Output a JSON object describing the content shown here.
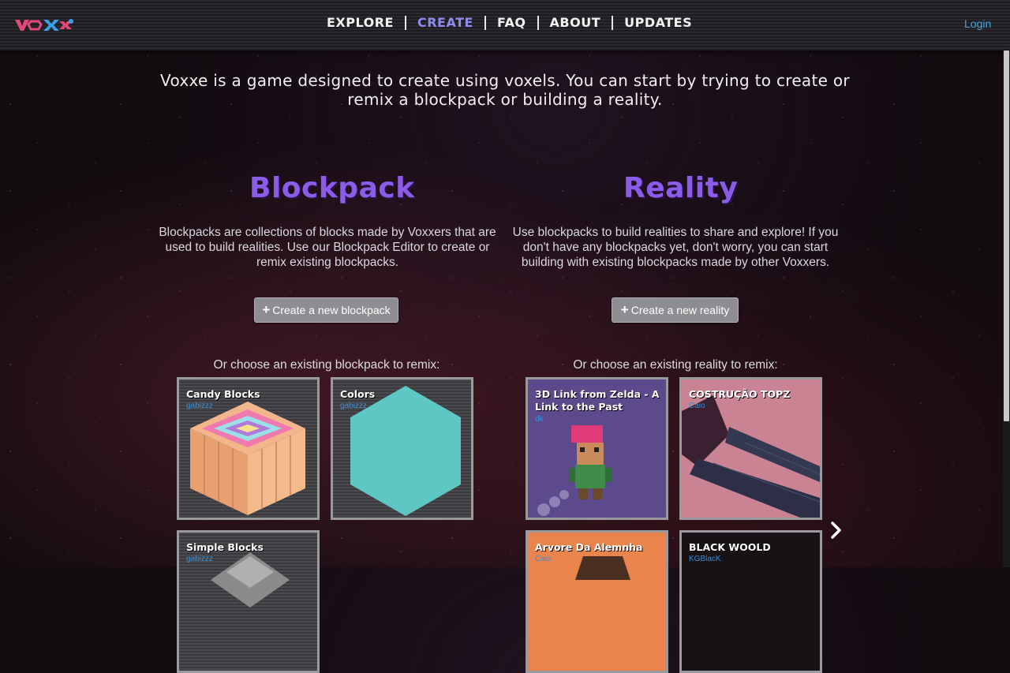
{
  "header": {
    "logo_text": "voxxe",
    "nav": [
      {
        "label": "EXPLORE",
        "active": false
      },
      {
        "label": "CREATE",
        "active": true
      },
      {
        "label": "FAQ",
        "active": false
      },
      {
        "label": "ABOUT",
        "active": false
      },
      {
        "label": "UPDATES",
        "active": false
      }
    ],
    "login_label": "Login"
  },
  "intro_text": "Voxxe is a game designed to create using voxels. You can start by trying to create or remix a blockpack or building a reality.",
  "blockpack": {
    "title": "Blockpack",
    "description": "Blockpacks are collections of blocks made by Voxxers that are used to build realities. Use our Blockpack Editor to create or remix existing blockpacks.",
    "create_button": "Create a new blockpack",
    "choose_text": "Or choose an existing blockpack to remix:",
    "items": [
      {
        "title": "Candy Blocks",
        "author": "gabizzz"
      },
      {
        "title": "Colors",
        "author": "gabizzz"
      },
      {
        "title": "Simple Blocks",
        "author": "gabizzz"
      }
    ]
  },
  "reality": {
    "title": "Reality",
    "description": "Use blockpacks to build realities to share and explore! If you don't have any blockpacks yet, don't worry, you can start building with existing blockpacks made by other Voxxers.",
    "create_button": "Create a new reality",
    "choose_text": "Or choose an existing reality to remix:",
    "items": [
      {
        "title": "3D Link from Zelda - A Link to the Past",
        "author": "dk"
      },
      {
        "title": "COSTRUÇÃO TOPZ",
        "author": "Caio"
      },
      {
        "title": "Arvore Da Alemnha",
        "author": "Caio"
      },
      {
        "title": "BLACK WOOLD",
        "author": "KGBlacK"
      }
    ]
  },
  "colors": {
    "accent_purple": "#8a5ce8",
    "nav_active": "#8f8cf0",
    "link_blue": "#4aa3df",
    "author_blue": "#3d8fd6"
  },
  "icons": {
    "plus": "+",
    "next": "chevron-right-icon"
  }
}
